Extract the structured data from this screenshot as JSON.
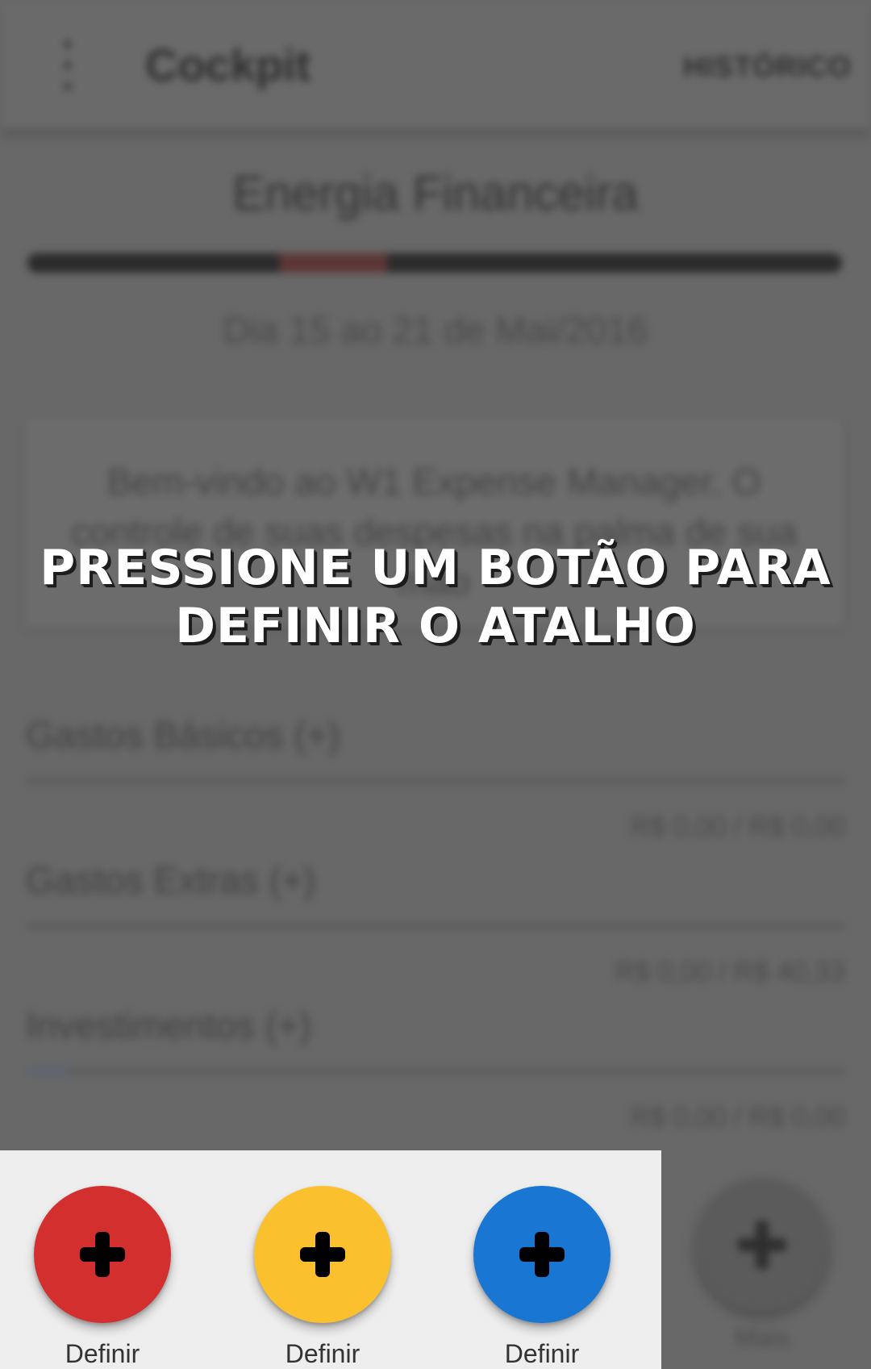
{
  "app_bar": {
    "title": "Cockpit",
    "history_label": "HISTÓRICO",
    "menu_icon": "more-vert-icon"
  },
  "energy": {
    "title": "Energia Financeira",
    "progress": 0.44,
    "period": "Dia 15 ao 21 de Mai/2016"
  },
  "welcome_message": "Bem-vindo ao W1 Expense Manager. O controle de suas despesas na palma de sua mão",
  "budgets": [
    {
      "name": "Gastos Básicos (+)",
      "amount": "R$ 0,00 / R$ 0,00",
      "progress": 0.0
    },
    {
      "name": "Gastos Extras (+)",
      "amount": "R$ 0,00 / R$ 40,33",
      "progress": 0.0
    },
    {
      "name": "Investimentos (+)",
      "amount": "R$ 0,00 / R$ 0,00",
      "progress": 0.05
    }
  ],
  "background_fab": {
    "label": "Mais",
    "icon": "plus-icon"
  },
  "overlay": {
    "prompt": "PRESSIONE UM BOTÃO PARA DEFINIR O ATALHO",
    "shortcuts": [
      {
        "label": "Definir",
        "color": "#d32f2f",
        "icon": "plus-icon"
      },
      {
        "label": "Definir",
        "color": "#fbc02d",
        "icon": "plus-icon"
      },
      {
        "label": "Definir",
        "color": "#1976d2",
        "icon": "plus-icon"
      }
    ]
  }
}
